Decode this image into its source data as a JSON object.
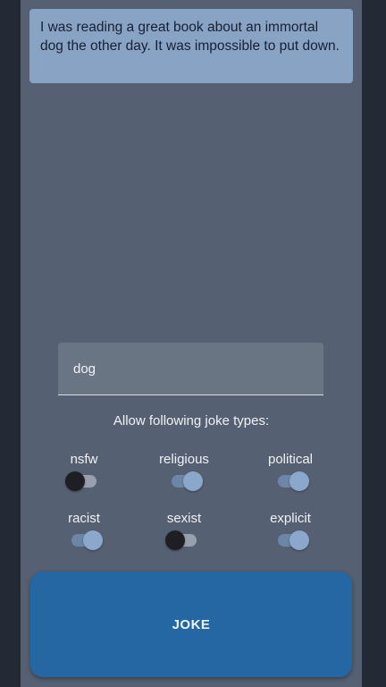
{
  "joke": {
    "text": "I was reading a great book about an immortal dog the other day. It was impossible to put down."
  },
  "search": {
    "value": "dog"
  },
  "filters": {
    "heading": "Allow following joke types:",
    "items": [
      {
        "label": "nsfw",
        "enabled": false
      },
      {
        "label": "religious",
        "enabled": true
      },
      {
        "label": "political",
        "enabled": true
      },
      {
        "label": "racist",
        "enabled": true
      },
      {
        "label": "sexist",
        "enabled": false
      },
      {
        "label": "explicit",
        "enabled": true
      }
    ]
  },
  "action": {
    "label": "JOKE"
  },
  "colors": {
    "background": "#556072",
    "card": "#89a3c4",
    "button": "#2567a2",
    "toggle_on": "#8ba8cc",
    "toggle_off_thumb": "#1e1f22"
  }
}
